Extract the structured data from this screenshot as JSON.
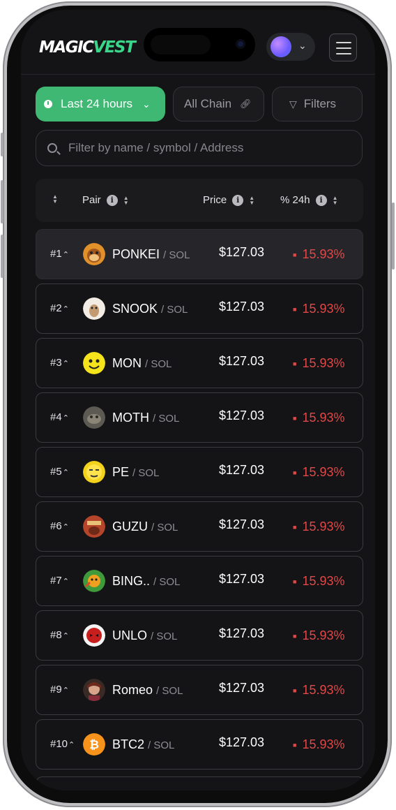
{
  "brand": {
    "logo_main": "MAGIC",
    "logo_accent": "VEST",
    "accent_color": "#3ad68a"
  },
  "filters": {
    "time_label": "Last 24 hours",
    "chain_label": "All Chain",
    "filters_label": "Filters",
    "search_placeholder": "Filter by name / symbol / Address"
  },
  "table": {
    "headers": {
      "pair": "Pair",
      "price": "Price",
      "change": "% 24h"
    },
    "rows": [
      {
        "rank": "#1",
        "symbol": "PONKEI",
        "quote": "SOL",
        "price": "$127.03",
        "change": "15.93%"
      },
      {
        "rank": "#2",
        "symbol": "SNOOK",
        "quote": "SOL",
        "price": "$127.03",
        "change": "15.93%"
      },
      {
        "rank": "#3",
        "symbol": "MON",
        "quote": "SOL",
        "price": "$127.03",
        "change": "15.93%"
      },
      {
        "rank": "#4",
        "symbol": "MOTH",
        "quote": "SOL",
        "price": "$127.03",
        "change": "15.93%"
      },
      {
        "rank": "#5",
        "symbol": "PE",
        "quote": "SOL",
        "price": "$127.03",
        "change": "15.93%"
      },
      {
        "rank": "#6",
        "symbol": "GUZU",
        "quote": "SOL",
        "price": "$127.03",
        "change": "15.93%"
      },
      {
        "rank": "#7",
        "symbol": "BING..",
        "quote": "SOL",
        "price": "$127.03",
        "change": "15.93%"
      },
      {
        "rank": "#8",
        "symbol": "UNLO",
        "quote": "SOL",
        "price": "$127.03",
        "change": "15.93%"
      },
      {
        "rank": "#9",
        "symbol": "Romeo",
        "quote": "SOL",
        "price": "$127.03",
        "change": "15.93%"
      },
      {
        "rank": "#10",
        "symbol": "BTC2",
        "quote": "SOL",
        "price": "$127.03",
        "change": "15.93%"
      }
    ]
  },
  "colors": {
    "positive_button": "#3eb872",
    "change_text": "#e14848",
    "background": "#141416"
  }
}
